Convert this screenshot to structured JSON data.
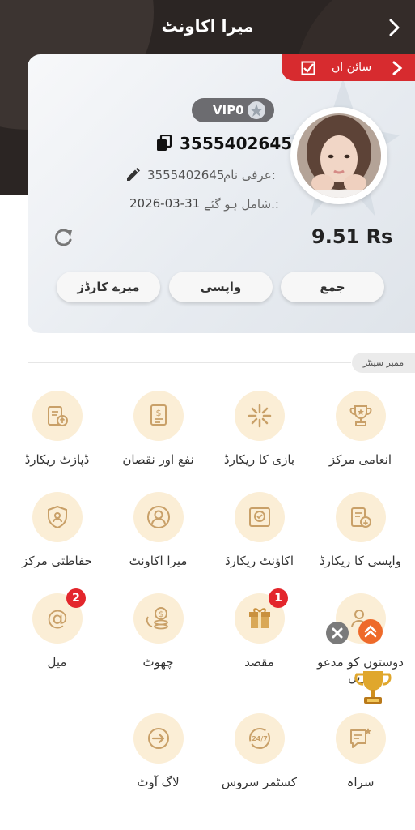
{
  "header": {
    "title": "میرا اکاونٹ"
  },
  "signin": {
    "label": "سائن ان"
  },
  "profile": {
    "vip": "VIP0",
    "uid": "3555402645",
    "nickname_label": "عرفی نام:",
    "nickname": "3555402645",
    "joined_label": "شامل ہو گئے.:",
    "joined_date": "2026-03-31",
    "balance": "9.51 Rs"
  },
  "actions": {
    "deposit": "جمع",
    "withdraw": "واپسی",
    "cards": "میرے کارڈز"
  },
  "member_center": {
    "label": "ممبر سینٹر"
  },
  "grid": [
    {
      "label": "انعامی مرکز",
      "icon": "trophy-icon"
    },
    {
      "label": "بازی کا ریکارڈ",
      "icon": "game-record-icon"
    },
    {
      "label": "نفع اور نقصان",
      "icon": "profit-loss-icon"
    },
    {
      "label": "ڈپازٹ ریکارڈ",
      "icon": "deposit-record-icon"
    },
    {
      "label": "واپسی کا ریکارڈ",
      "icon": "withdraw-record-icon"
    },
    {
      "label": "اکاؤنٹ ریکارڈ",
      "icon": "account-record-icon"
    },
    {
      "label": "میرا اکاونٹ",
      "icon": "user-icon"
    },
    {
      "label": "حفاظتی مرکز",
      "icon": "shield-icon"
    },
    {
      "label": "دوستوں کو مدعو کریں",
      "icon": "invite-icon"
    },
    {
      "label": "مقصد",
      "icon": "gift-icon",
      "badge": "1"
    },
    {
      "label": "چھوٹ",
      "icon": "coins-icon"
    },
    {
      "label": "میل",
      "icon": "mail-icon",
      "badge": "2"
    },
    {
      "label": "سراہ",
      "icon": "feedback-icon"
    },
    {
      "label": "کسٹمر سروس",
      "icon": "support-icon"
    },
    {
      "label": "لاگ آوٹ",
      "icon": "logout-icon"
    }
  ],
  "colors": {
    "accent": "#d72b2f",
    "icon_gold": "#c9a068",
    "icon_bg": "#fbeed6",
    "header_bg": "#2b2523"
  }
}
